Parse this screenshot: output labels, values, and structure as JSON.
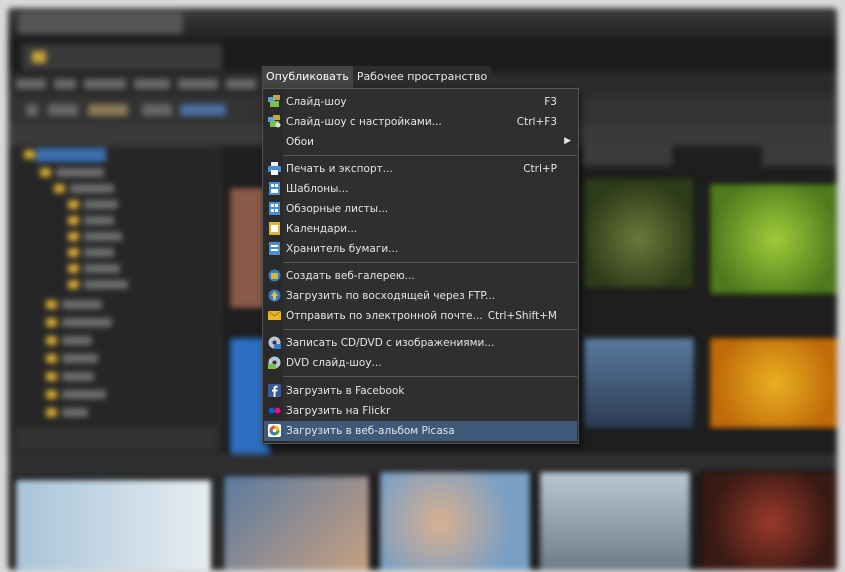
{
  "menubar": {
    "items": [
      "Опубликовать",
      "Рабочее пространство"
    ]
  },
  "menu": {
    "items": [
      {
        "label": "Слайд-шоу",
        "shortcut": "F3",
        "icon": "slideshow-icon"
      },
      {
        "label": "Слайд-шоу с настройками...",
        "shortcut": "Ctrl+F3",
        "icon": "slideshow-settings-icon"
      },
      {
        "label": "Обои",
        "shortcut": "",
        "icon": "",
        "submenu": true
      },
      {
        "label": "Печать и экспорт...",
        "shortcut": "Ctrl+P",
        "icon": "printer-icon"
      },
      {
        "label": "Шаблоны...",
        "shortcut": "",
        "icon": "templates-icon"
      },
      {
        "label": "Обзорные листы...",
        "shortcut": "",
        "icon": "contact-sheet-icon"
      },
      {
        "label": "Календари...",
        "shortcut": "",
        "icon": "calendar-icon"
      },
      {
        "label": "Хранитель бумаги...",
        "shortcut": "",
        "icon": "paper-saver-icon"
      },
      {
        "label": "Создать веб-галерею...",
        "shortcut": "",
        "icon": "web-gallery-icon"
      },
      {
        "label": "Загрузить по восходящей через FTP...",
        "shortcut": "",
        "icon": "ftp-upload-icon"
      },
      {
        "label": "Отправить по электронной почте...",
        "shortcut": "Ctrl+Shift+M",
        "icon": "email-icon"
      },
      {
        "label": "Записать CD/DVD с изображениями...",
        "shortcut": "",
        "icon": "cd-burn-icon"
      },
      {
        "label": "DVD слайд-шоу...",
        "shortcut": "",
        "icon": "dvd-slideshow-icon"
      },
      {
        "label": "Загрузить в Facebook",
        "shortcut": "",
        "icon": "facebook-icon"
      },
      {
        "label": "Загрузить на Flickr",
        "shortcut": "",
        "icon": "flickr-icon"
      },
      {
        "label": "Загрузить в веб-альбом Picasa",
        "shortcut": "",
        "icon": "picasa-icon",
        "highlighted": true
      }
    ],
    "submenu_arrow": "▶"
  },
  "colors": {
    "menu_bg": "#2f2f2f",
    "highlight": "#3e5a78",
    "text": "#e6e6e6",
    "folder": "#d3a930"
  }
}
